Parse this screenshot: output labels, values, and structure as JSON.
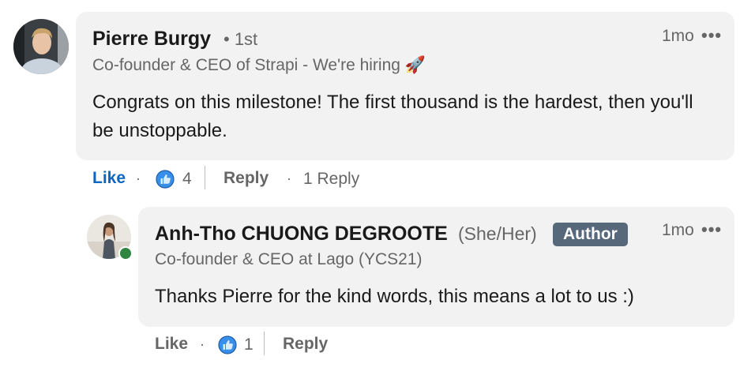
{
  "comment": {
    "author_name": "Pierre Burgy",
    "connection_degree": "• 1st",
    "headline": "Co-founder & CEO of Strapi - We're hiring 🚀",
    "time": "1mo",
    "more_icon": "•••",
    "text": "Congrats on this milestone! The first thousand is the hardest, then you'll be unstoppable.",
    "actions": {
      "like_label": "Like",
      "reaction_count": "4",
      "reply_label": "Reply",
      "replies_link": "1 Reply",
      "separator": "·"
    }
  },
  "reply": {
    "author_name": "Anh-Tho CHUONG DEGROOTE",
    "pronouns": "(She/Her)",
    "badge": "Author",
    "headline": "Co-founder & CEO at Lago (YCS21)",
    "time": "1mo",
    "more_icon": "•••",
    "text": "Thanks Pierre for the kind words, this means a lot to us :)",
    "actions": {
      "like_label": "Like",
      "reaction_count": "1",
      "reply_label": "Reply",
      "separator": "·"
    }
  },
  "colors": {
    "bubble": "#f2f2f2",
    "like_blue": "#0a66c2",
    "badge_bg": "#56687a",
    "online": "#2e8540"
  },
  "icons": [
    "avatar-pierre",
    "avatar-anh-tho",
    "more-options-icon",
    "like-reaction-icon",
    "online-status-icon"
  ]
}
